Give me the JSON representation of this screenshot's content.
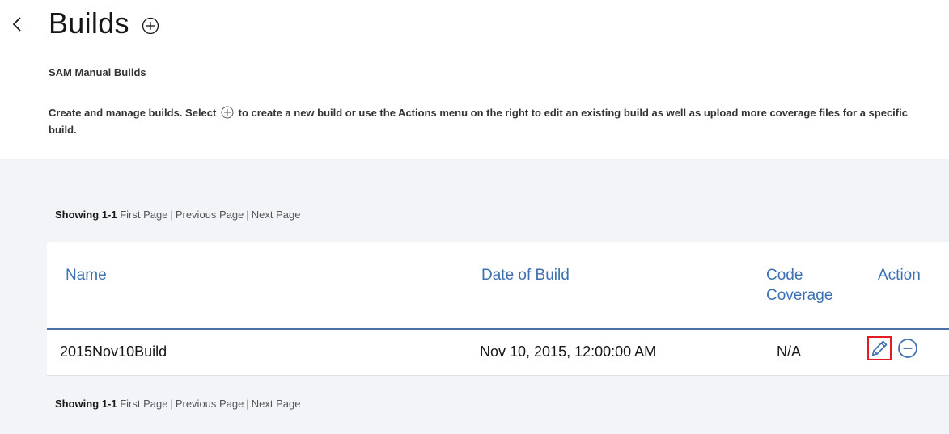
{
  "header": {
    "title": "Builds",
    "back_icon": "chevron-left-icon",
    "add_icon": "plus-circle-icon"
  },
  "subtitle": "SAM Manual Builds",
  "description": {
    "before_icon": "Create and manage builds. Select",
    "after_icon": "to create a new build or use the Actions menu on the right to edit an existing build as well as upload more coverage files for a specific build."
  },
  "pagination": {
    "showing": "Showing 1-1",
    "first": "First Page",
    "previous": "Previous Page",
    "next": "Next Page",
    "separator": "|"
  },
  "table": {
    "columns": [
      "Name",
      "Date of Build",
      "Code Coverage",
      "Action"
    ],
    "rows": [
      {
        "name": "2015Nov10Build",
        "date": "Nov 10, 2015, 12:00:00 AM",
        "coverage": "N/A"
      }
    ]
  },
  "colors": {
    "accent": "#3d70b2",
    "panel_bg": "#f2f4f8",
    "highlight": "#e31b23"
  }
}
